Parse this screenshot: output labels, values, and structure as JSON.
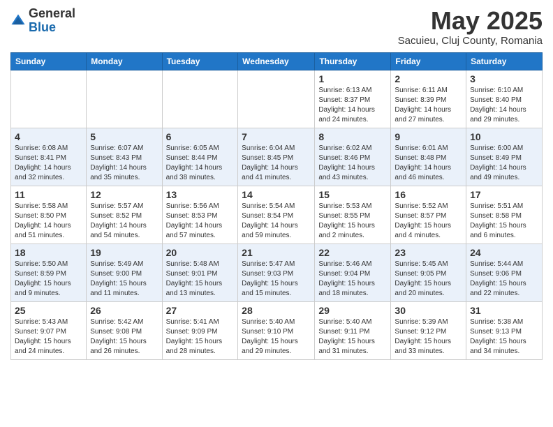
{
  "header": {
    "logo_general": "General",
    "logo_blue": "Blue",
    "month_title": "May 2025",
    "subtitle": "Sacuieu, Cluj County, Romania"
  },
  "days_of_week": [
    "Sunday",
    "Monday",
    "Tuesday",
    "Wednesday",
    "Thursday",
    "Friday",
    "Saturday"
  ],
  "weeks": [
    [
      {
        "num": "",
        "info": ""
      },
      {
        "num": "",
        "info": ""
      },
      {
        "num": "",
        "info": ""
      },
      {
        "num": "",
        "info": ""
      },
      {
        "num": "1",
        "info": "Sunrise: 6:13 AM\nSunset: 8:37 PM\nDaylight: 14 hours\nand 24 minutes."
      },
      {
        "num": "2",
        "info": "Sunrise: 6:11 AM\nSunset: 8:39 PM\nDaylight: 14 hours\nand 27 minutes."
      },
      {
        "num": "3",
        "info": "Sunrise: 6:10 AM\nSunset: 8:40 PM\nDaylight: 14 hours\nand 29 minutes."
      }
    ],
    [
      {
        "num": "4",
        "info": "Sunrise: 6:08 AM\nSunset: 8:41 PM\nDaylight: 14 hours\nand 32 minutes."
      },
      {
        "num": "5",
        "info": "Sunrise: 6:07 AM\nSunset: 8:43 PM\nDaylight: 14 hours\nand 35 minutes."
      },
      {
        "num": "6",
        "info": "Sunrise: 6:05 AM\nSunset: 8:44 PM\nDaylight: 14 hours\nand 38 minutes."
      },
      {
        "num": "7",
        "info": "Sunrise: 6:04 AM\nSunset: 8:45 PM\nDaylight: 14 hours\nand 41 minutes."
      },
      {
        "num": "8",
        "info": "Sunrise: 6:02 AM\nSunset: 8:46 PM\nDaylight: 14 hours\nand 43 minutes."
      },
      {
        "num": "9",
        "info": "Sunrise: 6:01 AM\nSunset: 8:48 PM\nDaylight: 14 hours\nand 46 minutes."
      },
      {
        "num": "10",
        "info": "Sunrise: 6:00 AM\nSunset: 8:49 PM\nDaylight: 14 hours\nand 49 minutes."
      }
    ],
    [
      {
        "num": "11",
        "info": "Sunrise: 5:58 AM\nSunset: 8:50 PM\nDaylight: 14 hours\nand 51 minutes."
      },
      {
        "num": "12",
        "info": "Sunrise: 5:57 AM\nSunset: 8:52 PM\nDaylight: 14 hours\nand 54 minutes."
      },
      {
        "num": "13",
        "info": "Sunrise: 5:56 AM\nSunset: 8:53 PM\nDaylight: 14 hours\nand 57 minutes."
      },
      {
        "num": "14",
        "info": "Sunrise: 5:54 AM\nSunset: 8:54 PM\nDaylight: 14 hours\nand 59 minutes."
      },
      {
        "num": "15",
        "info": "Sunrise: 5:53 AM\nSunset: 8:55 PM\nDaylight: 15 hours\nand 2 minutes."
      },
      {
        "num": "16",
        "info": "Sunrise: 5:52 AM\nSunset: 8:57 PM\nDaylight: 15 hours\nand 4 minutes."
      },
      {
        "num": "17",
        "info": "Sunrise: 5:51 AM\nSunset: 8:58 PM\nDaylight: 15 hours\nand 6 minutes."
      }
    ],
    [
      {
        "num": "18",
        "info": "Sunrise: 5:50 AM\nSunset: 8:59 PM\nDaylight: 15 hours\nand 9 minutes."
      },
      {
        "num": "19",
        "info": "Sunrise: 5:49 AM\nSunset: 9:00 PM\nDaylight: 15 hours\nand 11 minutes."
      },
      {
        "num": "20",
        "info": "Sunrise: 5:48 AM\nSunset: 9:01 PM\nDaylight: 15 hours\nand 13 minutes."
      },
      {
        "num": "21",
        "info": "Sunrise: 5:47 AM\nSunset: 9:03 PM\nDaylight: 15 hours\nand 15 minutes."
      },
      {
        "num": "22",
        "info": "Sunrise: 5:46 AM\nSunset: 9:04 PM\nDaylight: 15 hours\nand 18 minutes."
      },
      {
        "num": "23",
        "info": "Sunrise: 5:45 AM\nSunset: 9:05 PM\nDaylight: 15 hours\nand 20 minutes."
      },
      {
        "num": "24",
        "info": "Sunrise: 5:44 AM\nSunset: 9:06 PM\nDaylight: 15 hours\nand 22 minutes."
      }
    ],
    [
      {
        "num": "25",
        "info": "Sunrise: 5:43 AM\nSunset: 9:07 PM\nDaylight: 15 hours\nand 24 minutes."
      },
      {
        "num": "26",
        "info": "Sunrise: 5:42 AM\nSunset: 9:08 PM\nDaylight: 15 hours\nand 26 minutes."
      },
      {
        "num": "27",
        "info": "Sunrise: 5:41 AM\nSunset: 9:09 PM\nDaylight: 15 hours\nand 28 minutes."
      },
      {
        "num": "28",
        "info": "Sunrise: 5:40 AM\nSunset: 9:10 PM\nDaylight: 15 hours\nand 29 minutes."
      },
      {
        "num": "29",
        "info": "Sunrise: 5:40 AM\nSunset: 9:11 PM\nDaylight: 15 hours\nand 31 minutes."
      },
      {
        "num": "30",
        "info": "Sunrise: 5:39 AM\nSunset: 9:12 PM\nDaylight: 15 hours\nand 33 minutes."
      },
      {
        "num": "31",
        "info": "Sunrise: 5:38 AM\nSunset: 9:13 PM\nDaylight: 15 hours\nand 34 minutes."
      }
    ]
  ]
}
